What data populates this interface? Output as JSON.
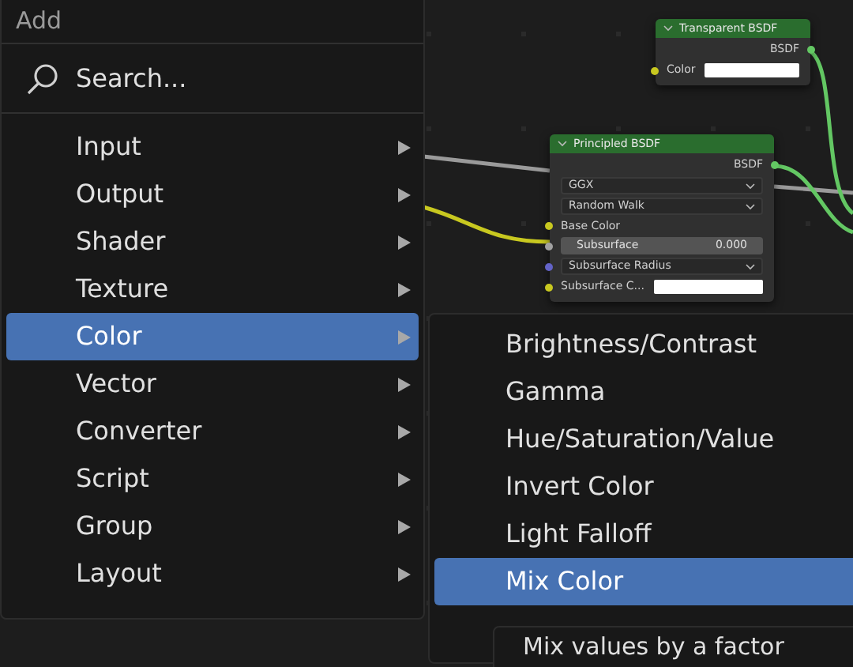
{
  "nodes": [
    {
      "title": "Transparent BSDF",
      "output": "BSDF",
      "rows": [
        {
          "kind": "color",
          "label": "Color",
          "color": "#c8c820"
        }
      ]
    },
    {
      "title": "Principled BSDF",
      "output": "BSDF",
      "rows": [
        {
          "kind": "dropdown",
          "label": "GGX"
        },
        {
          "kind": "dropdown",
          "label": "Random Walk"
        },
        {
          "kind": "socket",
          "label": "Base Color",
          "color": "#c8c820"
        },
        {
          "kind": "slider",
          "label": "Subsurface",
          "value": "0.000",
          "color": "#a1a1a1",
          "level": 0
        },
        {
          "kind": "dropdown",
          "label": "Subsurface Radius",
          "color": "#6363c7"
        },
        {
          "kind": "color",
          "label": "Subsurface C...",
          "color": "#c8c820"
        }
      ]
    }
  ],
  "menu": {
    "title": "Add",
    "search": {
      "label": "Search..."
    },
    "items": [
      {
        "label": "Input",
        "selected": false
      },
      {
        "label": "Output",
        "selected": false
      },
      {
        "label": "Shader",
        "selected": false
      },
      {
        "label": "Texture",
        "selected": false
      },
      {
        "label": "Color",
        "selected": true
      },
      {
        "label": "Vector",
        "selected": false
      },
      {
        "label": "Converter",
        "selected": false
      },
      {
        "label": "Script",
        "selected": false
      },
      {
        "label": "Group",
        "selected": false
      },
      {
        "label": "Layout",
        "selected": false
      }
    ]
  },
  "submenu": {
    "items": [
      {
        "label": "Brightness/Contrast",
        "selected": false
      },
      {
        "label": "Gamma",
        "selected": false
      },
      {
        "label": "Hue/Saturation/Value",
        "selected": false
      },
      {
        "label": "Invert Color",
        "selected": false
      },
      {
        "label": "Light Falloff",
        "selected": false
      },
      {
        "label": "Mix Color",
        "selected": true
      }
    ]
  },
  "tooltip": "Mix values by a factor"
}
